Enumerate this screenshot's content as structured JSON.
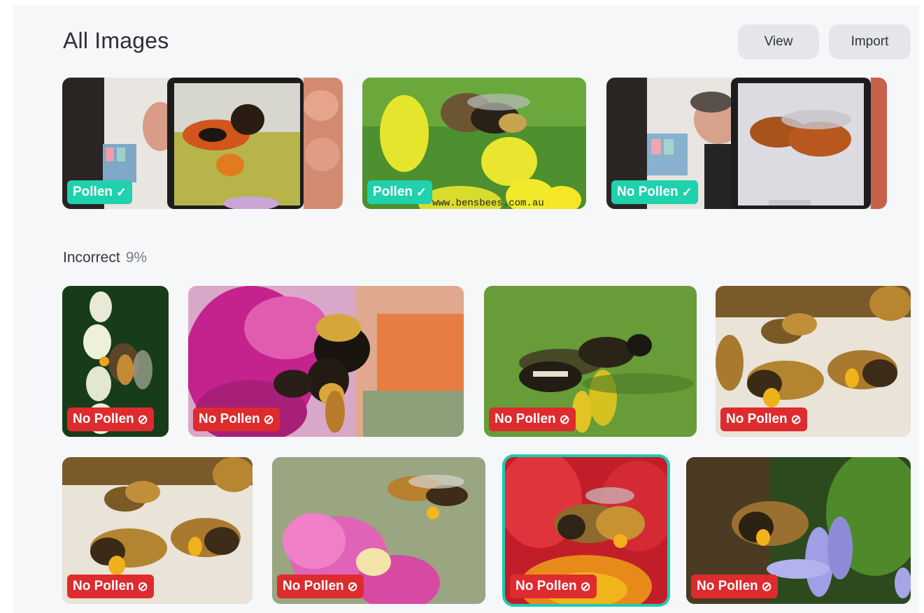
{
  "header": {
    "title": "All Images",
    "view_label": "View",
    "import_label": "Import"
  },
  "incorrect_section": {
    "label": "Incorrect",
    "percent": "9%"
  },
  "labels": {
    "pollen": "Pollen",
    "no_pollen": "No Pollen",
    "check_icon": "check-icon",
    "blocked_icon": "prohibited-icon"
  },
  "top_images": [
    {
      "label": "Pollen",
      "status": "correct",
      "subject": "bee photo on phone screen"
    },
    {
      "label": "Pollen",
      "status": "correct",
      "subject": "bee on yellow flowers",
      "watermark": "www.bensbees.com.au"
    },
    {
      "label": "No Pollen",
      "status": "correct",
      "subject": "bee photo on phone screen"
    }
  ],
  "incorrect_images": [
    {
      "label": "No Pollen",
      "status": "incorrect"
    },
    {
      "label": "No Pollen",
      "status": "incorrect"
    },
    {
      "label": "No Pollen",
      "status": "incorrect"
    },
    {
      "label": "No Pollen",
      "status": "incorrect"
    },
    {
      "label": "No Pollen",
      "status": "incorrect"
    },
    {
      "label": "No Pollen",
      "status": "incorrect"
    },
    {
      "label": "No Pollen",
      "status": "incorrect",
      "selected": true
    },
    {
      "label": "No Pollen",
      "status": "incorrect"
    }
  ],
  "colors": {
    "correct_badge": "#1fd1ad",
    "incorrect_badge": "#dd2b2e",
    "selection": "#19cdb0"
  }
}
